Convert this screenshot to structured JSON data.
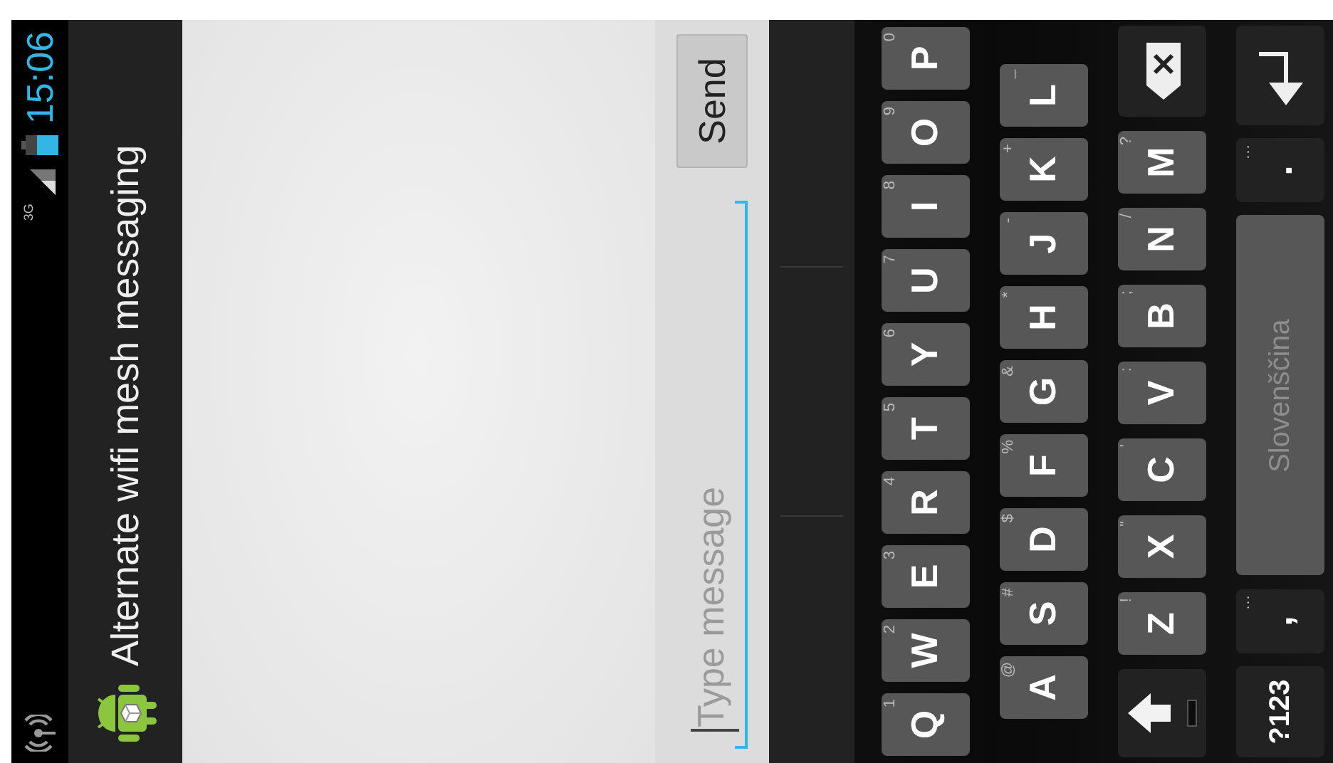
{
  "status_bar": {
    "network": "3G",
    "time": "15:06"
  },
  "action_bar": {
    "title": "Alternate wifi mesh messaging"
  },
  "compose": {
    "placeholder": "Type message",
    "send": "Send"
  },
  "keyboard": {
    "top_row": [
      {
        "kind": "letter",
        "label": "Q",
        "hint": "1"
      },
      {
        "kind": "letter",
        "label": "W",
        "hint": "2"
      },
      {
        "kind": "letter",
        "label": "E",
        "hint": "3"
      },
      {
        "kind": "letter",
        "label": "R",
        "hint": "4"
      },
      {
        "kind": "letter",
        "label": "T",
        "hint": "5"
      },
      {
        "kind": "letter",
        "label": "Y",
        "hint": "6"
      },
      {
        "kind": "letter",
        "label": "U",
        "hint": "7"
      },
      {
        "kind": "letter",
        "label": "I",
        "hint": "8"
      },
      {
        "kind": "letter",
        "label": "O",
        "hint": "9"
      },
      {
        "kind": "letter",
        "label": "P",
        "hint": "0"
      }
    ],
    "home_row": [
      {
        "kind": "letter",
        "label": "A",
        "hint": "@"
      },
      {
        "kind": "letter",
        "label": "S",
        "hint": "#"
      },
      {
        "kind": "letter",
        "label": "D",
        "hint": "$"
      },
      {
        "kind": "letter",
        "label": "F",
        "hint": "%"
      },
      {
        "kind": "letter",
        "label": "G",
        "hint": "&"
      },
      {
        "kind": "letter",
        "label": "H",
        "hint": "*"
      },
      {
        "kind": "letter",
        "label": "J",
        "hint": "-"
      },
      {
        "kind": "letter",
        "label": "K",
        "hint": "+"
      },
      {
        "kind": "letter",
        "label": "L",
        "hint": "_"
      }
    ],
    "bottom_row": [
      {
        "kind": "shift"
      },
      {
        "kind": "letter",
        "label": "Z",
        "hint": "!"
      },
      {
        "kind": "letter",
        "label": "X",
        "hint": "\""
      },
      {
        "kind": "letter",
        "label": "C",
        "hint": "'"
      },
      {
        "kind": "letter",
        "label": "V",
        "hint": ":"
      },
      {
        "kind": "letter",
        "label": "B",
        "hint": ";"
      },
      {
        "kind": "letter",
        "label": "N",
        "hint": "/"
      },
      {
        "kind": "letter",
        "label": "M",
        "hint": "?"
      },
      {
        "kind": "backspace"
      }
    ],
    "function_row": [
      {
        "kind": "symbols",
        "label": "?123"
      },
      {
        "kind": "punct",
        "label": ",",
        "hint": "…"
      },
      {
        "kind": "space",
        "label": "Slovenščina"
      },
      {
        "kind": "punct",
        "label": ".",
        "hint": "…"
      },
      {
        "kind": "enter"
      }
    ]
  }
}
